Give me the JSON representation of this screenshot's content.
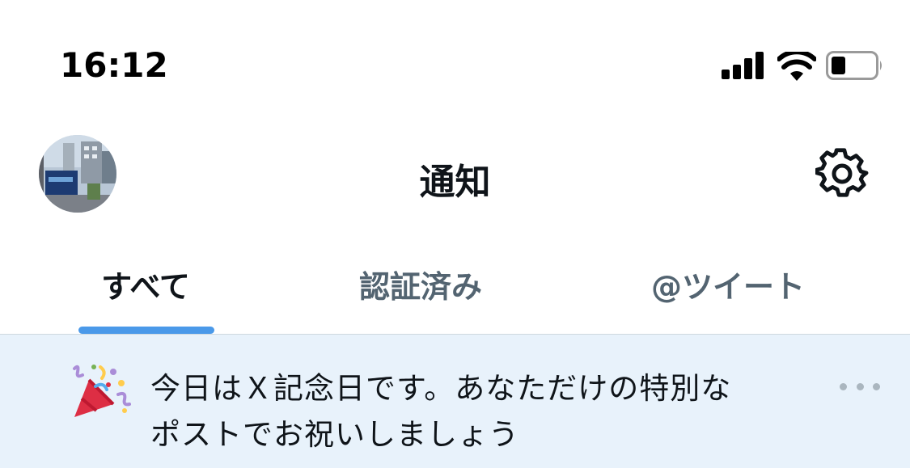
{
  "status_bar": {
    "time": "16:12",
    "icons": [
      "signal-icon",
      "wifi-icon",
      "battery-icon"
    ]
  },
  "header": {
    "title": "通知",
    "avatar": "avatar",
    "settings_icon": "gear-icon"
  },
  "tabs": [
    {
      "label": "すべて",
      "active": true
    },
    {
      "label": "認証済み",
      "active": false
    },
    {
      "label": "@ツイート",
      "active": false
    }
  ],
  "banner": {
    "icon": "party-popper-icon",
    "line1": "今日はＸ記念日です。あなただけの特別な",
    "line2": "ポストでお祝いしましょう",
    "more_icon": "more-icon"
  },
  "colors": {
    "accent": "#4a99e9",
    "banner_bg": "#e8f2fb",
    "text_primary": "#0f1419",
    "text_secondary": "#536471"
  }
}
